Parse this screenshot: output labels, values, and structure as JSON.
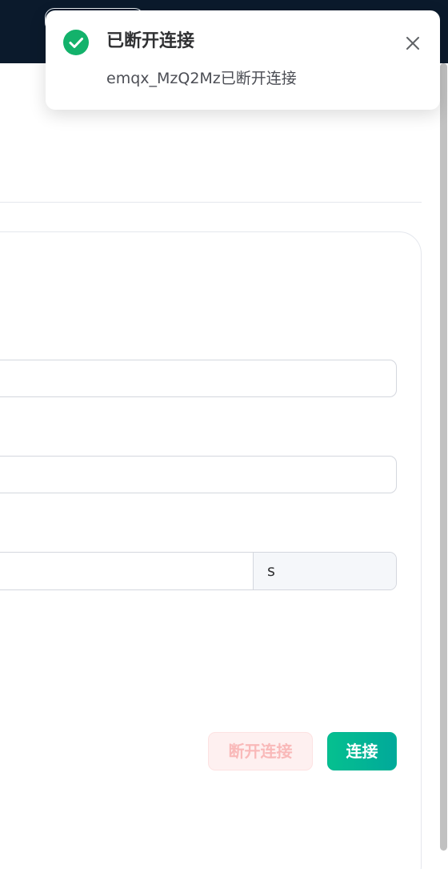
{
  "toast": {
    "title": "已断开连接",
    "message": "emqx_MzQ2Mz已断开连接",
    "icon": "check-circle-icon",
    "close_icon": "close-icon",
    "status_color": "#13b26b"
  },
  "form": {
    "interval_unit": "s"
  },
  "buttons": {
    "disconnect_label": "断开连接",
    "connect_label": "连接"
  },
  "colors": {
    "accent": "#02b49a",
    "header_bg": "#0b1a2c",
    "danger_light": "#fef0f0"
  }
}
